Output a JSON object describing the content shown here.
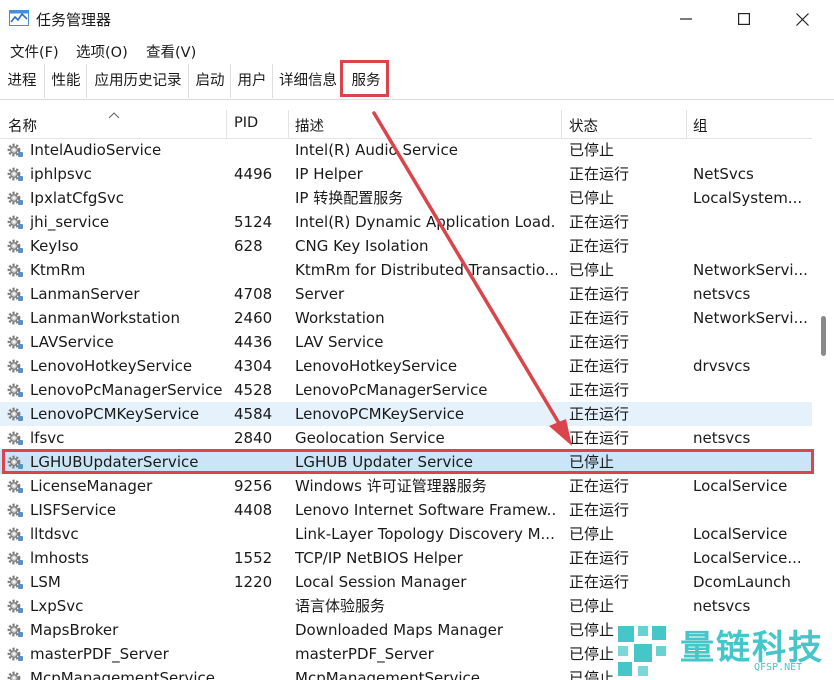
{
  "window": {
    "title": "任务管理器",
    "controls": [
      "minimize-icon",
      "maximize-icon",
      "close-icon"
    ]
  },
  "menu": [
    "文件(F)",
    "选项(O)",
    "查看(V)"
  ],
  "tabs": [
    "进程",
    "性能",
    "应用历史记录",
    "启动",
    "用户",
    "详细信息",
    "服务"
  ],
  "active_tab": "服务",
  "columns": {
    "name": "名称",
    "pid": "PID",
    "desc": "描述",
    "status": "状态",
    "group": "组"
  },
  "rows": [
    {
      "name": "IntelAudioService",
      "pid": "",
      "desc": "Intel(R) Audio Service",
      "status": "已停止",
      "group": ""
    },
    {
      "name": "iphlpsvc",
      "pid": "4496",
      "desc": "IP Helper",
      "status": "正在运行",
      "group": "NetSvcs"
    },
    {
      "name": "IpxlatCfgSvc",
      "pid": "",
      "desc": "IP 转换配置服务",
      "status": "已停止",
      "group": "LocalSystem..."
    },
    {
      "name": "jhi_service",
      "pid": "5124",
      "desc": "Intel(R) Dynamic Application Load...",
      "status": "正在运行",
      "group": ""
    },
    {
      "name": "KeyIso",
      "pid": "628",
      "desc": "CNG Key Isolation",
      "status": "正在运行",
      "group": ""
    },
    {
      "name": "KtmRm",
      "pid": "",
      "desc": "KtmRm for Distributed Transactio...",
      "status": "已停止",
      "group": "NetworkServi..."
    },
    {
      "name": "LanmanServer",
      "pid": "4708",
      "desc": "Server",
      "status": "正在运行",
      "group": "netsvcs"
    },
    {
      "name": "LanmanWorkstation",
      "pid": "2460",
      "desc": "Workstation",
      "status": "正在运行",
      "group": "NetworkServi..."
    },
    {
      "name": "LAVService",
      "pid": "4436",
      "desc": "LAV Service",
      "status": "正在运行",
      "group": ""
    },
    {
      "name": "LenovoHotkeyService",
      "pid": "4304",
      "desc": "LenovoHotkeyService",
      "status": "正在运行",
      "group": "drvsvcs"
    },
    {
      "name": "LenovoPcManagerService",
      "pid": "4528",
      "desc": "LenovoPcManagerService",
      "status": "正在运行",
      "group": ""
    },
    {
      "name": "LenovoPCMKeyService",
      "pid": "4584",
      "desc": "LenovoPCMKeyService",
      "status": "正在运行",
      "group": ""
    },
    {
      "name": "lfsvc",
      "pid": "2840",
      "desc": "Geolocation Service",
      "status": "正在运行",
      "group": "netsvcs"
    },
    {
      "name": "LGHUBUpdaterService",
      "pid": "",
      "desc": "LGHUB Updater Service",
      "status": "已停止",
      "group": ""
    },
    {
      "name": "LicenseManager",
      "pid": "9256",
      "desc": "Windows 许可证管理器服务",
      "status": "正在运行",
      "group": "LocalService"
    },
    {
      "name": "LISFService",
      "pid": "4408",
      "desc": "Lenovo Internet Software Framew...",
      "status": "正在运行",
      "group": ""
    },
    {
      "name": "lltdsvc",
      "pid": "",
      "desc": "Link-Layer Topology Discovery M...",
      "status": "已停止",
      "group": "LocalService"
    },
    {
      "name": "lmhosts",
      "pid": "1552",
      "desc": "TCP/IP NetBIOS Helper",
      "status": "正在运行",
      "group": "LocalService..."
    },
    {
      "name": "LSM",
      "pid": "1220",
      "desc": "Local Session Manager",
      "status": "正在运行",
      "group": "DcomLaunch"
    },
    {
      "name": "LxpSvc",
      "pid": "",
      "desc": "语言体验服务",
      "status": "已停止",
      "group": "netsvcs"
    },
    {
      "name": "MapsBroker",
      "pid": "",
      "desc": "Downloaded Maps Manager",
      "status": "已停止",
      "group": ""
    },
    {
      "name": "masterPDF_Server",
      "pid": "",
      "desc": "masterPDF_Server",
      "status": "已停止",
      "group": ""
    },
    {
      "name": "McpManagementService",
      "pid": "",
      "desc": "McpManagementService",
      "status": "已停止",
      "group": ""
    }
  ],
  "hover_row": "LenovoPCMKeyService",
  "selected_row": "LGHUBUpdaterService",
  "watermark": {
    "brand": "量链科技",
    "domain": "QFSP.NET"
  },
  "colors": {
    "annotation_red": "#d9454a",
    "selected_row_bg": "#cce4f7",
    "hover_row_bg": "#e5f1fb",
    "watermark_teal": "#45c6c8"
  }
}
